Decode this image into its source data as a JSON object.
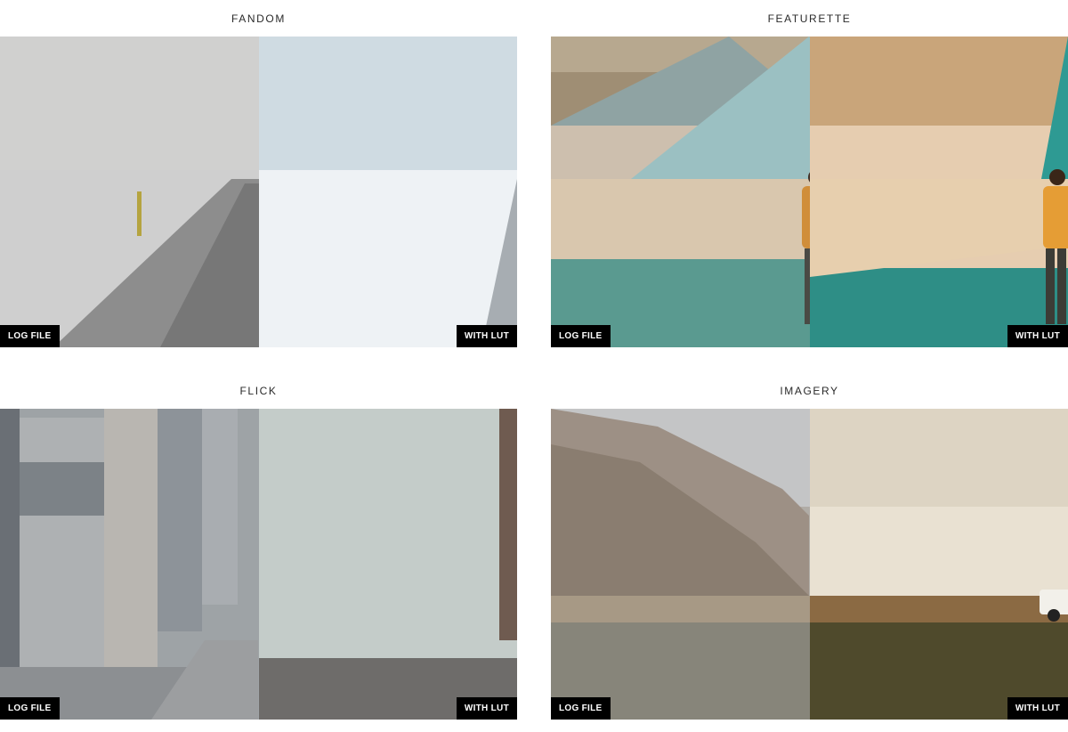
{
  "cards": [
    {
      "title": "FANDOM",
      "log_label": "LOG FILE",
      "lut_label": "WITH LUT"
    },
    {
      "title": "FEATURETTE",
      "log_label": "LOG FILE",
      "lut_label": "WITH LUT"
    },
    {
      "title": "FLICK",
      "log_label": "LOG FILE",
      "lut_label": "WITH LUT"
    },
    {
      "title": "IMAGERY",
      "log_label": "LOG FILE",
      "lut_label": "WITH LUT"
    }
  ]
}
